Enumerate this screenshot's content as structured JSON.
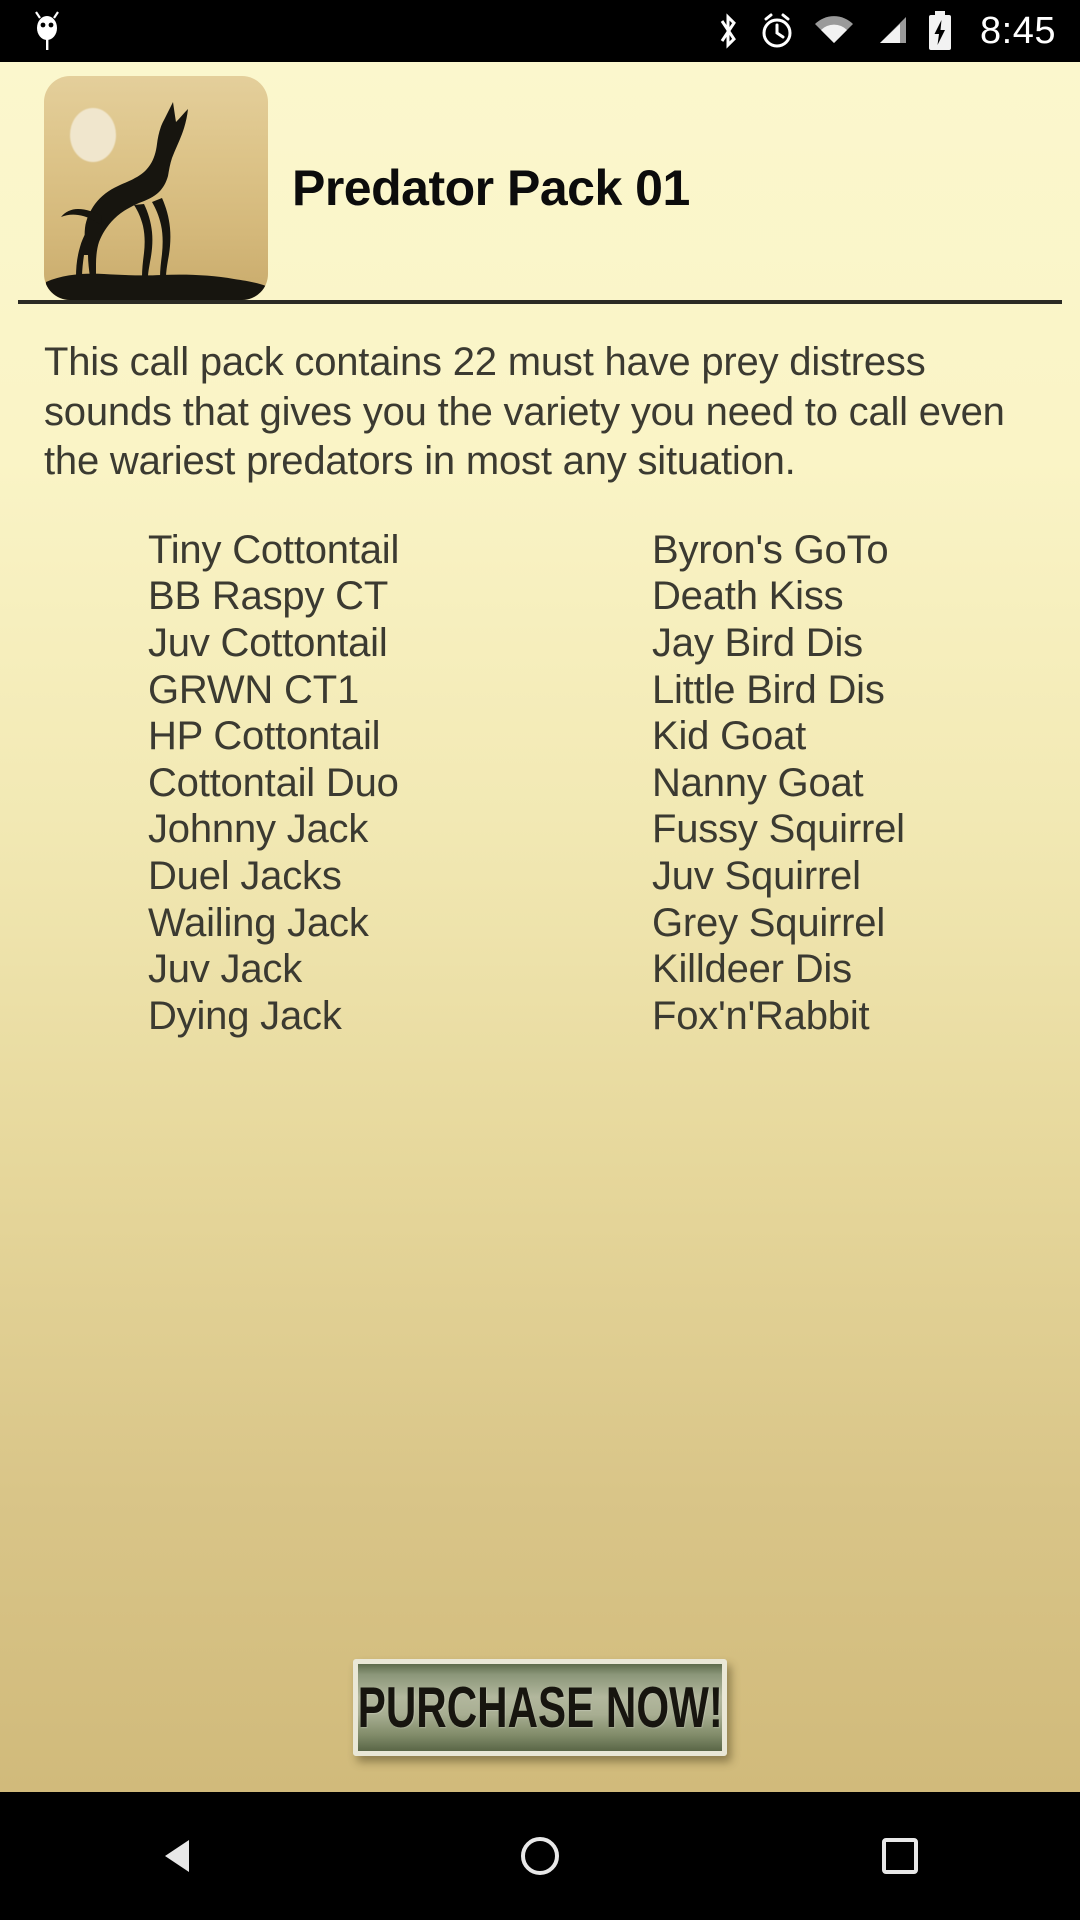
{
  "statusbar": {
    "time": "8:45",
    "icons": [
      "android-bug-icon",
      "bluetooth-icon",
      "alarm-icon",
      "wifi-icon",
      "cell-signal-icon",
      "battery-charging-icon"
    ]
  },
  "header": {
    "title": "Predator Pack 01",
    "icon_name": "howling-wolf-icon"
  },
  "description": "This call pack contains 22 must have prey distress sounds that gives you the variety you need to call even the wariest predators in most any situation.",
  "sound_list": {
    "left_column": [
      "Tiny Cottontail",
      "BB Raspy CT",
      "Juv Cottontail",
      "GRWN CT1",
      "HP Cottontail",
      "Cottontail Duo",
      "Johnny Jack",
      "Duel Jacks",
      "Wailing Jack",
      "Juv Jack",
      "Dying Jack"
    ],
    "right_column": [
      "Byron's GoTo",
      "Death Kiss",
      "Jay Bird Dis",
      "Little Bird Dis",
      "Kid Goat",
      "Nanny Goat",
      "Fussy Squirrel",
      "Juv Squirrel",
      "Grey Squirrel",
      "Killdeer Dis",
      "Fox'n'Rabbit"
    ]
  },
  "purchase": {
    "label": "PURCHASE NOW!"
  },
  "navbar": {
    "back": "back-triangle-icon",
    "home": "home-circle-icon",
    "recents": "recents-square-icon"
  },
  "colors": {
    "bg_top": "#fbf7cd",
    "bg_bottom": "#cfb878",
    "text": "#3b3a31",
    "title": "#0c0c0c",
    "divider": "#2b2a24",
    "button_green": "#8b9679"
  }
}
